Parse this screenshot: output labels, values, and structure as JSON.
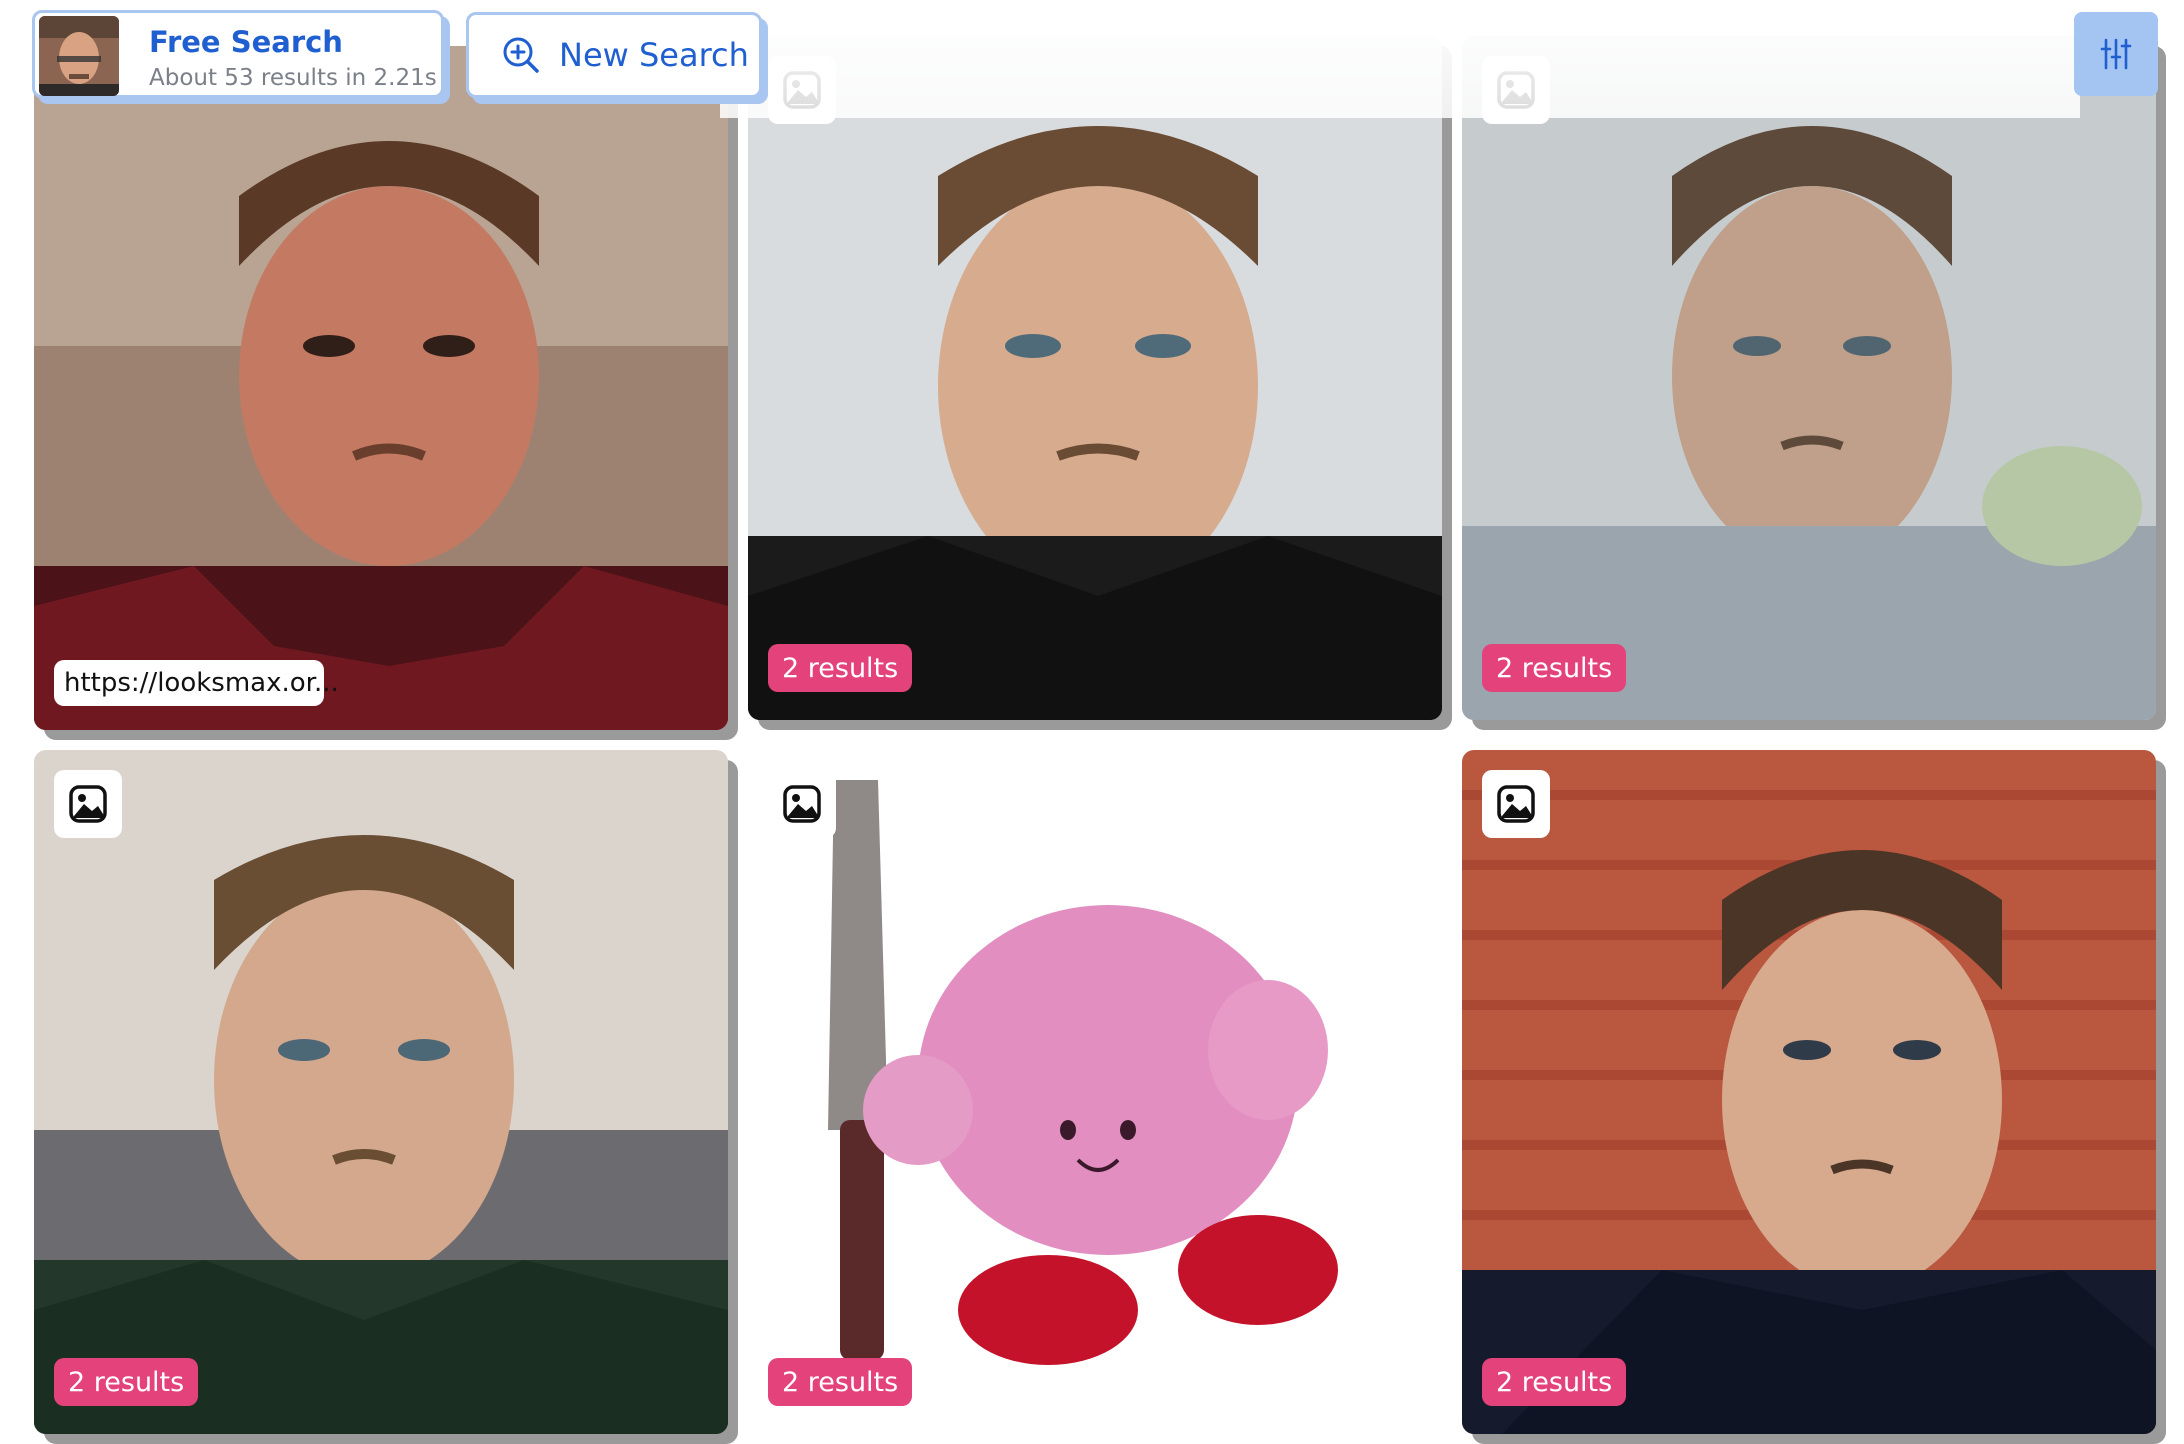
{
  "header": {
    "search_title": "Free Search",
    "search_subtitle": "About 53 results in 2.21s",
    "new_search_label": "New Search",
    "filter_icon": "sliders-icon"
  },
  "colors": {
    "accent_blue": "#1f5fd0",
    "border_blue": "#a9c6f1",
    "badge_pink": "#e4427a"
  },
  "results": [
    {
      "badge": "https://looksmax.or...",
      "type": "url"
    },
    {
      "badge": "2 results",
      "type": "count"
    },
    {
      "badge": "2 results",
      "type": "count"
    },
    {
      "badge": "2 results",
      "type": "count"
    },
    {
      "badge": "2 results",
      "type": "count"
    },
    {
      "badge": "2 results",
      "type": "count"
    }
  ]
}
